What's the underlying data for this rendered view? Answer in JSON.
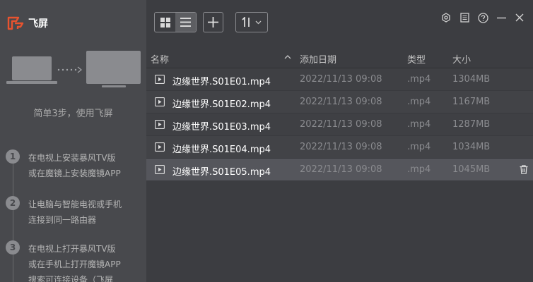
{
  "app": {
    "name": "飞屏"
  },
  "sidebar": {
    "title": "简单3步，使用飞屏",
    "steps": [
      {
        "num": "1",
        "lines": [
          "在电视上安装暴风TV版",
          "或在魔镜上安装魔镜APP"
        ]
      },
      {
        "num": "2",
        "lines": [
          "让电脑与智能电视或手机",
          "连接到同一路由器"
        ]
      },
      {
        "num": "3",
        "lines": [
          "在电视上打开暴风TV版",
          "或在手机上打开魔镜APP",
          "搜索可连接设备（飞屏"
        ]
      }
    ]
  },
  "toolbar": {
    "icons": [
      "grid-view-icon",
      "list-view-icon",
      "plus-icon",
      "sort-icon",
      "chevron-down-icon"
    ],
    "active_view": "list"
  },
  "window_controls": [
    "settings-icon",
    "notes-icon",
    "help-icon",
    "minimize-icon",
    "close-icon"
  ],
  "table": {
    "headers": {
      "name": "名称",
      "date": "添加日期",
      "type": "类型",
      "size": "大小"
    },
    "sort_column": "name",
    "rows": [
      {
        "name": "边缘世界.S01E01.mp4",
        "date": "2022/11/13 09:08",
        "type": ".mp4",
        "size": "1304MB"
      },
      {
        "name": "边缘世界.S01E02.mp4",
        "date": "2022/11/13 09:08",
        "type": ".mp4",
        "size": "1167MB"
      },
      {
        "name": "边缘世界.S01E03.mp4",
        "date": "2022/11/13 09:08",
        "type": ".mp4",
        "size": "1287MB"
      },
      {
        "name": "边缘世界.S01E04.mp4",
        "date": "2022/11/13 09:08",
        "type": ".mp4",
        "size": "1034MB"
      },
      {
        "name": "边缘世界.S01E05.mp4",
        "date": "2022/11/13 09:08",
        "type": ".mp4",
        "size": "1045MB"
      }
    ],
    "selected_row": 4
  },
  "colors": {
    "accent": "#e8532f",
    "sidebar_bg": "#48494d",
    "main_bg": "#3c3d41",
    "selected_row": "#55565c"
  }
}
